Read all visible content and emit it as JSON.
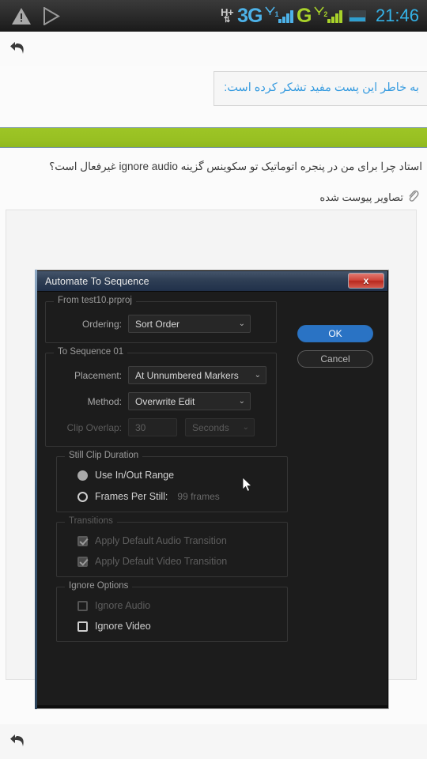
{
  "statusbar": {
    "warning_icon": "warning-triangle-icon",
    "play_store_icon": "play-store-icon",
    "network_speed_label": "H+",
    "network_type_1": "3G",
    "network_type_2": "G",
    "sim1_label": "1",
    "sim2_label": "2",
    "battery_icon": "battery-icon",
    "clock": "21:46",
    "colors": {
      "cyan": "#4db2e8",
      "green": "#a8d22a",
      "clock": "#34b3e8"
    }
  },
  "nav": {
    "back_top": "back-arrow",
    "back_bottom": "back-arrow"
  },
  "post": {
    "thanks_quote": "به خاطر این پست مفید تشکر کرده است:",
    "question": "استاد چرا برای من در پنجره اتوماتیک تو سکوینس گزینه ignore audio غیرفعال است؟",
    "attachment_label": "تصاویر پیوست شده",
    "green_bar_color": "#98c022"
  },
  "dialog": {
    "title": "Automate To Sequence",
    "close_label": "x",
    "buttons": {
      "ok": "OK",
      "cancel": "Cancel"
    },
    "from_group": {
      "legend": "From test10.prproj",
      "ordering_label": "Ordering:",
      "ordering_value": "Sort Order"
    },
    "to_group": {
      "legend": "To Sequence 01",
      "placement_label": "Placement:",
      "placement_value": "At Unnumbered Markers",
      "method_label": "Method:",
      "method_value": "Overwrite Edit",
      "clip_overlap_label": "Clip Overlap:",
      "clip_overlap_value": "30",
      "clip_overlap_units": "Seconds"
    },
    "still_clip_group": {
      "legend": "Still Clip Duration",
      "use_in_out_label": "Use In/Out Range",
      "frames_per_still_label": "Frames Per Still:",
      "frames_per_still_value": "99 frames"
    },
    "transitions_group": {
      "legend": "Transitions",
      "audio_transition_label": "Apply Default Audio Transition",
      "video_transition_label": "Apply Default Video Transition"
    },
    "ignore_group": {
      "legend": "Ignore Options",
      "ignore_audio_label": "Ignore Audio",
      "ignore_video_label": "Ignore Video"
    },
    "accent_color": "#2a73c4"
  }
}
